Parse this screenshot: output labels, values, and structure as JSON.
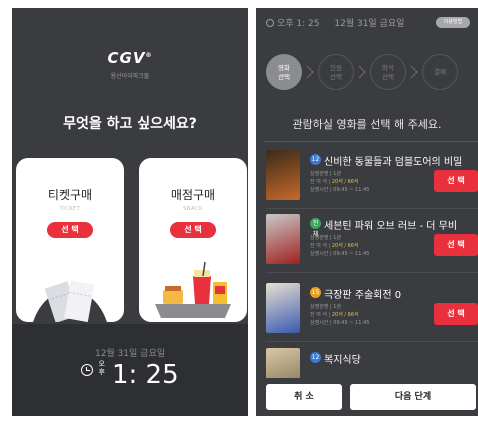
{
  "left_screen": {
    "logo": "CGV",
    "logo_mark": "®",
    "logo_sub": "용산아이파크몰",
    "question": "무엇을 하고 싶으세요?",
    "cards": [
      {
        "title": "티켓구매",
        "sub": "TICKET",
        "button": "선 택",
        "art": "ticket-illustration"
      },
      {
        "title": "매점구매",
        "sub": "SNACK",
        "button": "선 택",
        "art": "snack-tray-illustration"
      }
    ],
    "date": "12월 31일 금요일",
    "ampm": [
      "오",
      "후"
    ],
    "time": "1: 25"
  },
  "right_screen": {
    "status": {
      "time": "오후 1: 25",
      "date": "12월 31일 금요일",
      "pill": "이용방법"
    },
    "steps": [
      {
        "line1": "영화",
        "line2": "선택",
        "active": true
      },
      {
        "line1": "인원",
        "line2": "선택",
        "active": false
      },
      {
        "line1": "좌석",
        "line2": "선택",
        "active": false
      },
      {
        "line1": "결제",
        "line2": "",
        "active": false
      }
    ],
    "header": "관람하실 영화를 선택 해 주세요.",
    "movies": [
      {
        "grade": "12",
        "grade_color": "#3a7bd5",
        "title": "신비한 동물들과 덤블도어의 비밀",
        "info1": "상영관명 | 1관",
        "info2_label": "잔 여 석 | ",
        "info2_value": "20석 / 66석",
        "info3": "상영시간 | 09:45 ~ 11:45",
        "button": "선 택",
        "poster_colors": [
          "#3a2a1a",
          "#c86a2a"
        ]
      },
      {
        "grade": "전체",
        "grade_color": "#3aa55a",
        "title": "세븐틴 파워 오브 러브 - 더 무비",
        "info1": "상영관명 | 1관",
        "info2_label": "잔 여 석 | ",
        "info2_value": "20석 / 66석",
        "info3": "상영시간 | 09:45 ~ 11:45",
        "button": "선 택",
        "poster_colors": [
          "#c9c9c9",
          "#a02020"
        ]
      },
      {
        "grade": "15",
        "grade_color": "#e8a020",
        "title": "극장판 주술회전 0",
        "info1": "상영관명 | 1관",
        "info2_label": "잔 여 석 | ",
        "info2_value": "20석 / 66석",
        "info3": "상영시간 | 09:45 ~ 11:45",
        "button": "선 택",
        "poster_colors": [
          "#e8e0d0",
          "#3a5ab0"
        ]
      },
      {
        "grade": "12",
        "grade_color": "#3a7bd5",
        "title": "복지식당",
        "info1": "",
        "info2_label": "",
        "info2_value": "",
        "info3": "",
        "button": "",
        "poster_colors": [
          "#d8c8a8",
          "#7a6a4a"
        ]
      }
    ],
    "footer": {
      "cancel": "취 소",
      "next": "다음 단계"
    }
  }
}
